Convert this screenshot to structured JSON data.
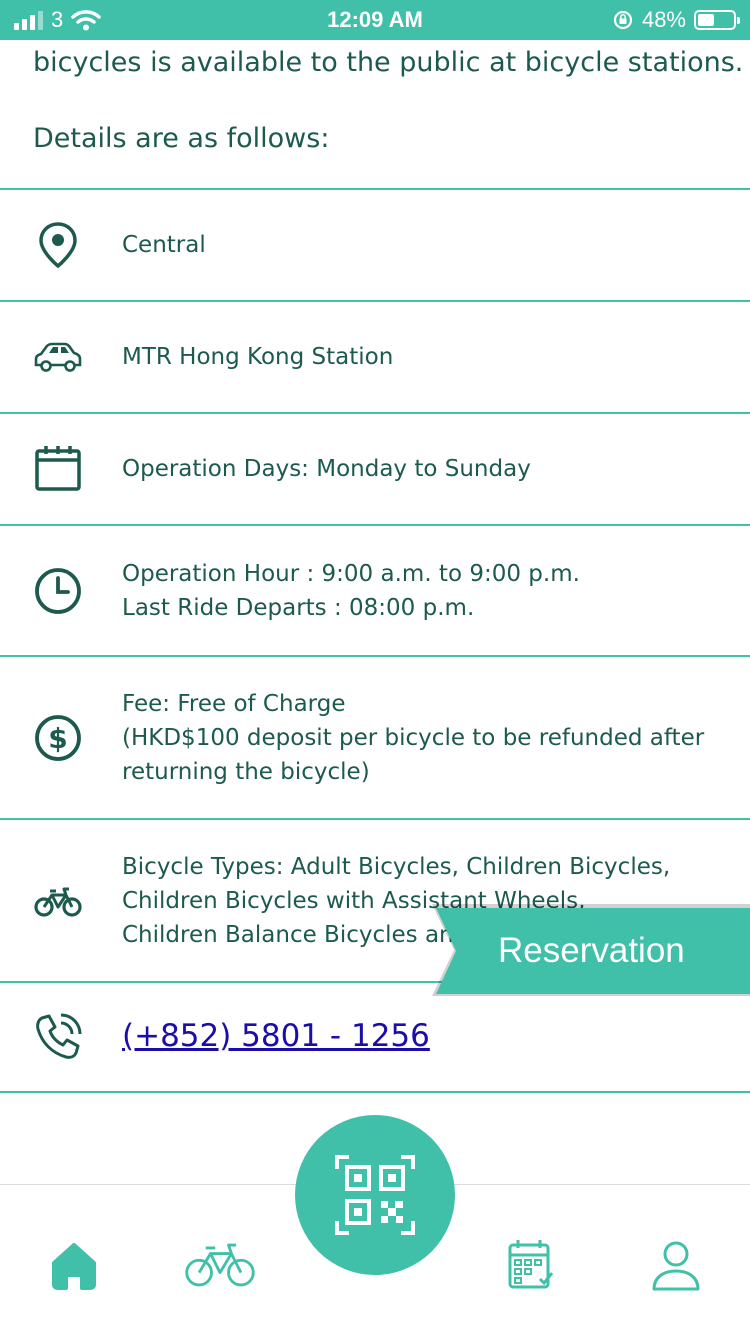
{
  "status_bar": {
    "carrier": "3",
    "time": "12:09 AM",
    "battery": "48%",
    "battery_level": 0.48
  },
  "intro": {
    "line1": "bicycles is available to the public at bicycle stations.",
    "line2": "Details are as follows:"
  },
  "details": {
    "district": {
      "icon": "location-pin-icon",
      "text": "Central"
    },
    "station": {
      "icon": "car-icon",
      "text": "MTR Hong Kong Station"
    },
    "days": {
      "icon": "calendar-icon",
      "text": "Operation Days: Monday to Sunday"
    },
    "hours": {
      "icon": "clock-icon",
      "line1": "Operation Hour : 9:00 a.m. to 9:00 p.m.",
      "line2": "Last Ride Departs : 08:00 p.m."
    },
    "fee": {
      "icon": "dollar-icon",
      "line1": "Fee: Free of Charge",
      "line2": "(HKD$100 deposit per bicycle to be refunded after",
      "line3": "returning the bicycle)"
    },
    "bike_types": {
      "icon": "bicycle-icon",
      "line1": "Bicycle Types: Adult Bicycles, Children Bicycles,",
      "line2": "Children Bicycles with Assistant Wheels,",
      "line3": "Children Balance Bicycles and Tandem Bicycles"
    },
    "phone": {
      "icon": "phone-icon",
      "text": "(+852) 5801 - 1256"
    }
  },
  "reservation_label": "Reservation",
  "bottom_nav": {
    "items": [
      {
        "icon": "home-icon"
      },
      {
        "icon": "bicycle-icon"
      },
      {
        "icon": "qr-code-icon"
      },
      {
        "icon": "calendar-check-icon"
      },
      {
        "icon": "profile-icon"
      }
    ]
  },
  "colors": {
    "accent": "#41c0a9",
    "text": "#1d5a4e",
    "link": "#1a0dab"
  }
}
